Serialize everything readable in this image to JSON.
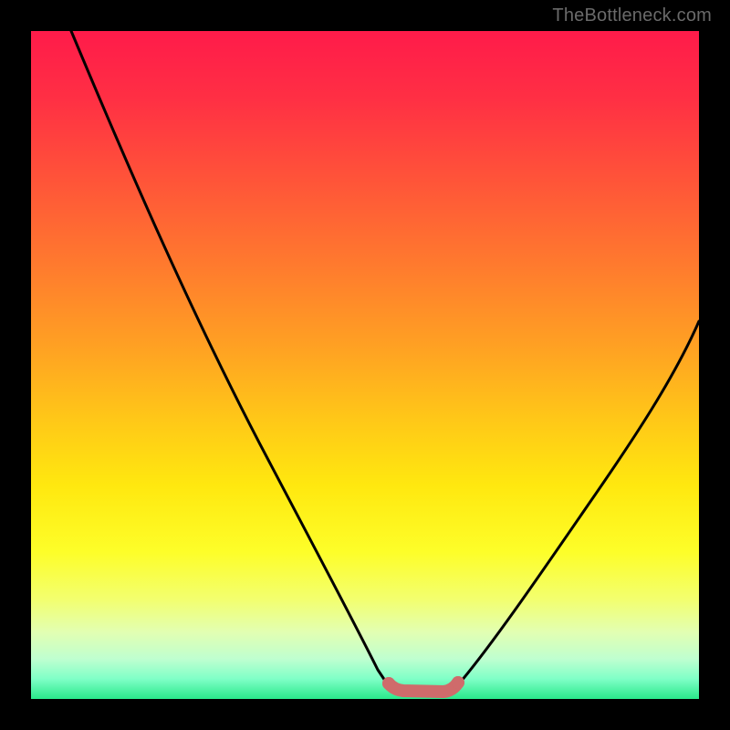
{
  "watermark": "TheBottleneck.com",
  "colors": {
    "frame": "#000000",
    "curve": "#000000",
    "marker": "#d46a6a",
    "gradient_top": "#ff1b4a",
    "gradient_bottom": "#29e98a"
  },
  "chart_data": {
    "type": "line",
    "title": "",
    "xlabel": "",
    "ylabel": "",
    "xlim": [
      0,
      100
    ],
    "ylim": [
      0,
      100
    ],
    "grid": false,
    "legend": false,
    "notes": "No axis ticks or numeric labels are rendered; values below are read off by relative position within the plot area (0 = left/bottom, 100 = right/top).",
    "series": [
      {
        "name": "left-descending-curve",
        "x": [
          6,
          10,
          15,
          20,
          25,
          30,
          35,
          40,
          45,
          50,
          52
        ],
        "y": [
          100,
          89,
          77,
          65,
          53,
          42,
          31,
          21,
          12,
          4,
          2
        ]
      },
      {
        "name": "valley-flat-marker",
        "x": [
          52,
          55,
          58,
          61,
          63
        ],
        "y": [
          2,
          1.5,
          1.5,
          1.6,
          2
        ],
        "style": "thick-rounded",
        "color": "#d46a6a"
      },
      {
        "name": "right-ascending-curve",
        "x": [
          63,
          68,
          73,
          78,
          83,
          88,
          93,
          98,
          100
        ],
        "y": [
          2,
          6,
          12,
          19,
          27,
          35,
          44,
          53,
          57
        ]
      }
    ]
  }
}
